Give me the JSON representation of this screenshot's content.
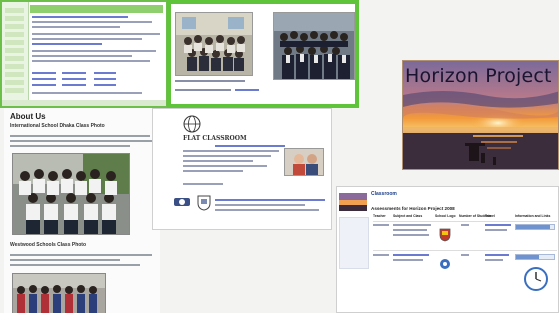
{
  "banner": {
    "title": "Horizon Project"
  },
  "about_page": {
    "heading": "About Us",
    "photo1_caption": "International School Dhaka Class Photo",
    "photo2_caption": "Westwood Schools Class Photo"
  },
  "flat_page": {
    "logo_text": "FLAT CLASSROOM"
  },
  "wiki_page": {
    "tag": "Classroom",
    "title": "Assessments for Horizon Project 2008",
    "columns": [
      "Teacher",
      "Subject and Class",
      "School Logo",
      "Number of Students",
      "Travel",
      "Information and Links"
    ],
    "progress": [
      0.9,
      0.6
    ]
  },
  "colors": {
    "green_frame": "#5fc43a",
    "sunset_orange": "#f39a3a",
    "sky_purple": "#6b5a8c"
  }
}
